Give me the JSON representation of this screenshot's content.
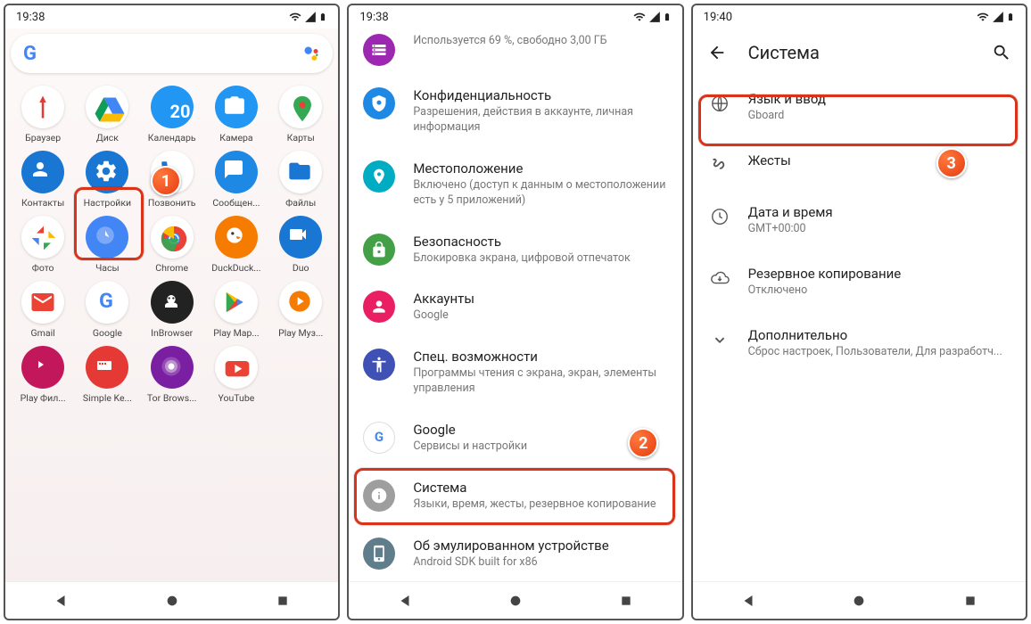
{
  "screen1": {
    "time": "19:38",
    "apps": [
      {
        "label": "Браузер",
        "bg": "#fff",
        "kind": "yandex"
      },
      {
        "label": "Диск",
        "bg": "#fff",
        "kind": "drive"
      },
      {
        "label": "Календарь",
        "bg": "#2196f3",
        "kind": "calendar",
        "text": "20"
      },
      {
        "label": "Камера",
        "bg": "#2196f3",
        "kind": "camera"
      },
      {
        "label": "Карты",
        "bg": "#fff",
        "kind": "maps"
      },
      {
        "label": "Контакты",
        "bg": "#1976d2",
        "kind": "contacts"
      },
      {
        "label": "Настройки",
        "bg": "#1976d2",
        "kind": "settings"
      },
      {
        "label": "Позвонить",
        "bg": "#fff",
        "kind": "phone"
      },
      {
        "label": "Сообщен...",
        "bg": "#1e88e5",
        "kind": "messages"
      },
      {
        "label": "Файлы",
        "bg": "#fff",
        "kind": "files"
      },
      {
        "label": "Фото",
        "bg": "#fff",
        "kind": "photos"
      },
      {
        "label": "Часы",
        "bg": "#4285f4",
        "kind": "clock"
      },
      {
        "label": "Chrome",
        "bg": "#fff",
        "kind": "chrome"
      },
      {
        "label": "DuckDuck...",
        "bg": "#f57c00",
        "kind": "duck"
      },
      {
        "label": "Duo",
        "bg": "#1976d2",
        "kind": "duo"
      },
      {
        "label": "Gmail",
        "bg": "#fff",
        "kind": "gmail"
      },
      {
        "label": "Google",
        "bg": "#fff",
        "kind": "google"
      },
      {
        "label": "InBrowser",
        "bg": "#222",
        "kind": "inbrowser"
      },
      {
        "label": "Play Мар...",
        "bg": "#fff",
        "kind": "play"
      },
      {
        "label": "Play Муз...",
        "bg": "#fff",
        "kind": "playmusic"
      },
      {
        "label": "Play Фил...",
        "bg": "#c2185b",
        "kind": "playfilm"
      },
      {
        "label": "Simple Ke...",
        "bg": "#e53935",
        "kind": "simplekey"
      },
      {
        "label": "Tor Brows...",
        "bg": "#7b1fa2",
        "kind": "tor"
      },
      {
        "label": "YouTube",
        "bg": "#fff",
        "kind": "youtube"
      }
    ]
  },
  "screen2": {
    "time": "19:38",
    "top_partial": "Используется 69 %, свободно 3,00 ГБ",
    "items": [
      {
        "title": "Конфиденциальность",
        "sub": "Разрешения, действия в аккаунте, личная информация",
        "color": "#1e88e5",
        "icon": "shield"
      },
      {
        "title": "Местоположение",
        "sub": "Включено (доступ к данным о местоположении есть у 5 приложений)",
        "color": "#00acc1",
        "icon": "pin"
      },
      {
        "title": "Безопасность",
        "sub": "Блокировка экрана, цифровой отпечаток",
        "color": "#43a047",
        "icon": "lock"
      },
      {
        "title": "Аккаунты",
        "sub": "Google",
        "color": "#e91e63",
        "icon": "account"
      },
      {
        "title": "Спец. возможности",
        "sub": "Программы чтения с экрана, экран, элементы управления",
        "color": "#3f51b5",
        "icon": "a11y"
      },
      {
        "title": "Google",
        "sub": "Сервисы и настройки",
        "color": "#fff",
        "icon": "g"
      },
      {
        "title": "Система",
        "sub": "Языки, время, жесты, резервное копирование",
        "color": "#9e9e9e",
        "icon": "info"
      },
      {
        "title": "Об эмулированном устройстве",
        "sub": "Android SDK built for x86",
        "color": "#607d8b",
        "icon": "device"
      }
    ]
  },
  "screen3": {
    "time": "19:40",
    "header": "Система",
    "items": [
      {
        "title": "Язык и ввод",
        "sub": "Gboard",
        "icon": "globe"
      },
      {
        "title": "Жесты",
        "sub": "",
        "icon": "gesture"
      },
      {
        "title": "Дата и время",
        "sub": "GMT+00:00",
        "icon": "clock"
      },
      {
        "title": "Резервное копирование",
        "sub": "Отключено",
        "icon": "backup"
      },
      {
        "title": "Дополнительно",
        "sub": "Сброс настроек, Пользователи, Для разработч...",
        "icon": "expand"
      }
    ]
  },
  "badges": {
    "b1": "1",
    "b2": "2",
    "b3": "3"
  }
}
